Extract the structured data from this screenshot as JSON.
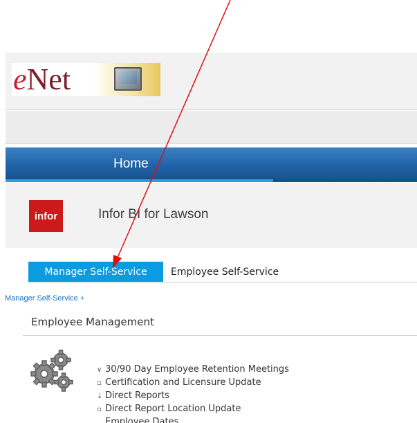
{
  "logo": {
    "text_first": "e",
    "text_rest": "Net"
  },
  "nav": {
    "home_label": "Home"
  },
  "infor": {
    "logo_text": "infor",
    "title": "Infor BI for Lawson"
  },
  "tabs": [
    {
      "label": "Manager Self-Service",
      "active": true
    },
    {
      "label": "Employee Self-Service",
      "active": false
    }
  ],
  "breadcrumb": "Manager Self-Service +",
  "section": {
    "title": "Employee Management",
    "icon": "gears-icon",
    "links": [
      {
        "bullet": "∨",
        "label": "30/90 Day Employee Retention Meetings"
      },
      {
        "bullet": "▫",
        "label": "Certification and Licensure Update"
      },
      {
        "bullet": "⇣",
        "label": "Direct Reports"
      },
      {
        "bullet": "▫",
        "label": "Direct Report Location Update"
      },
      {
        "bullet": "ˌ",
        "label": "Employee Dates"
      }
    ]
  },
  "colors": {
    "nav_blue": "#1f5fa3",
    "tab_active": "#0a9be0",
    "infor_red": "#cc1a1a",
    "arrow_red": "#e01010"
  }
}
